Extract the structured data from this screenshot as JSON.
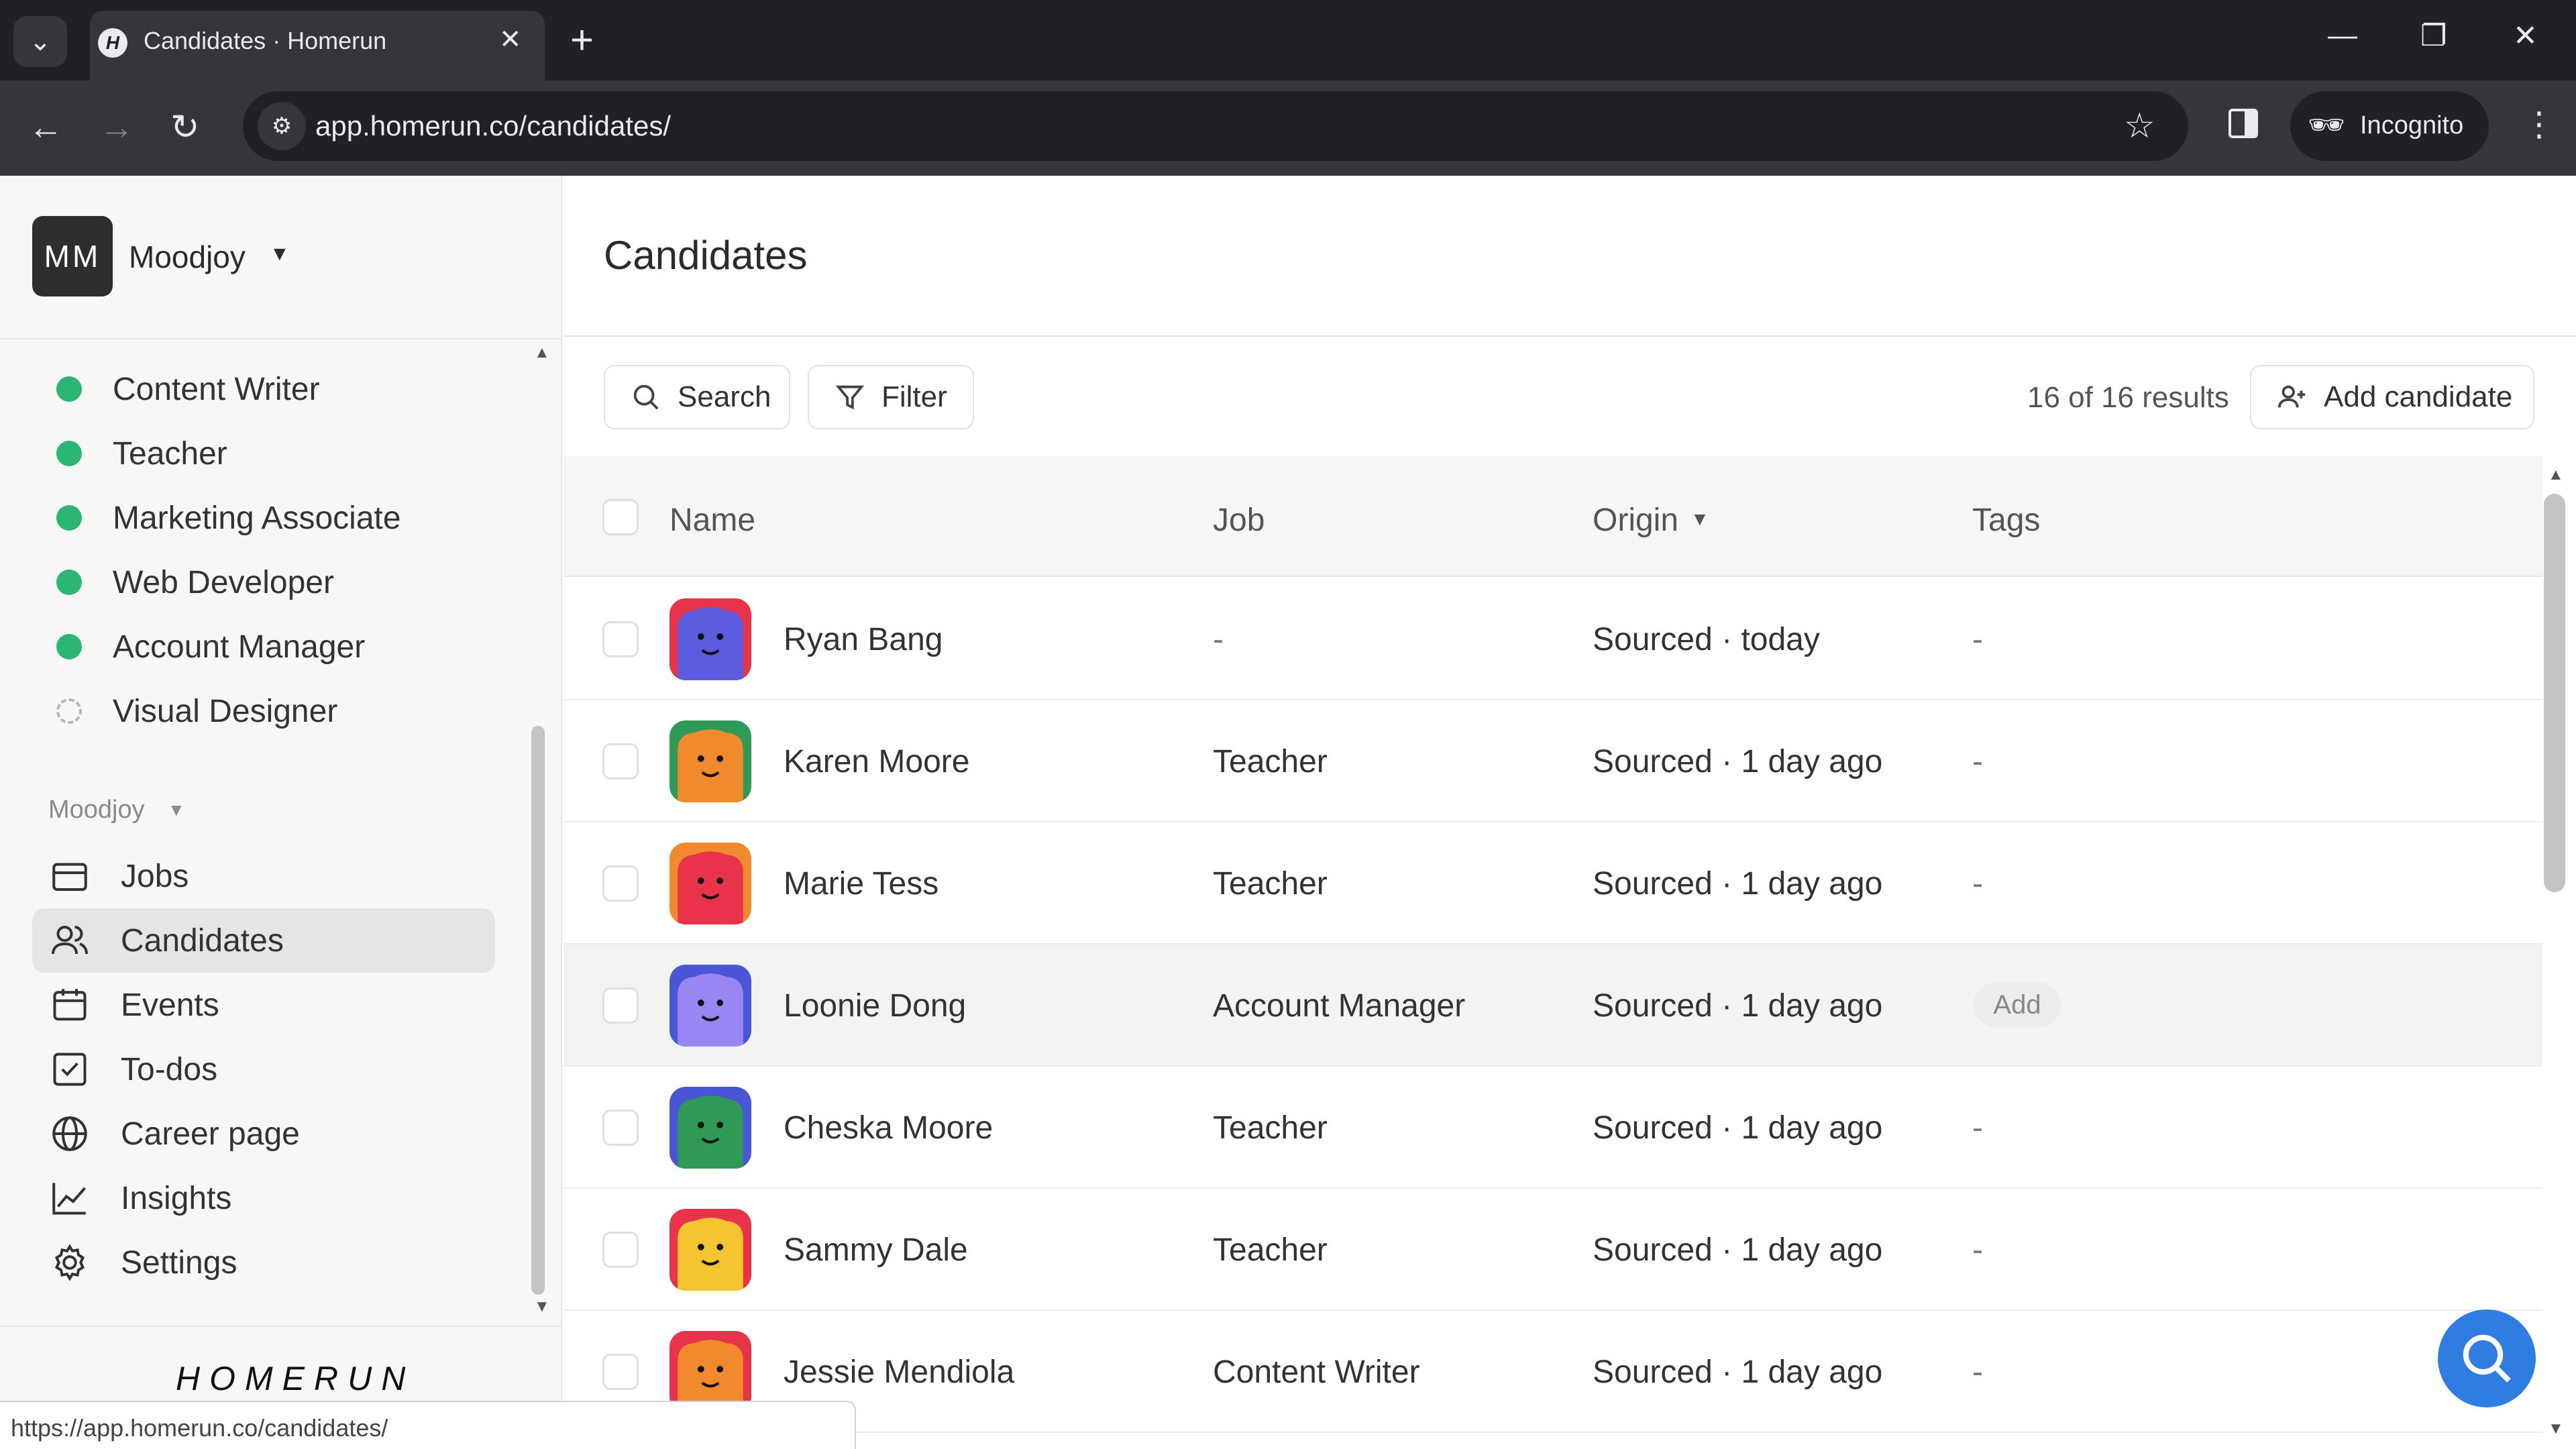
{
  "browser": {
    "tab_title": "Candidates · Homerun",
    "tab_favicon_letter": "H",
    "url": "app.homerun.co/candidates/",
    "incognito_label": "Incognito",
    "status_url": "https://app.homerun.co/candidates/"
  },
  "workspace": {
    "initials": "MM",
    "name": "Moodjoy"
  },
  "sidebar": {
    "jobs": [
      {
        "label": "Content Writer",
        "status": "published"
      },
      {
        "label": "Teacher",
        "status": "published"
      },
      {
        "label": "Marketing Associate",
        "status": "published"
      },
      {
        "label": "Web Developer",
        "status": "published"
      },
      {
        "label": "Account Manager",
        "status": "published"
      },
      {
        "label": "Visual Designer",
        "status": "draft"
      }
    ],
    "section_label": "Moodjoy",
    "nav": [
      {
        "label": "Jobs",
        "icon": "briefcase-icon"
      },
      {
        "label": "Candidates",
        "icon": "users-icon"
      },
      {
        "label": "Events",
        "icon": "calendar-icon"
      },
      {
        "label": "To-dos",
        "icon": "checkbox-icon"
      },
      {
        "label": "Career page",
        "icon": "globe-icon"
      },
      {
        "label": "Insights",
        "icon": "chart-icon"
      },
      {
        "label": "Settings",
        "icon": "gear-icon"
      }
    ],
    "active_nav": "Candidates",
    "brand": "HOMERUN"
  },
  "main": {
    "title": "Candidates",
    "search_label": "Search",
    "filter_label": "Filter",
    "results": "16 of 16 results",
    "add_candidate_label": "Add candidate",
    "columns": {
      "name": "Name",
      "job": "Job",
      "origin": "Origin",
      "tags": "Tags"
    },
    "rows": [
      {
        "name": "Ryan Bang",
        "job": "-",
        "origin": "Sourced · today",
        "tags": "-",
        "avatar_bg": "#e8334a",
        "avatar_fg": "#5b5ce0"
      },
      {
        "name": "Karen Moore",
        "job": "Teacher",
        "origin": "Sourced · 1 day ago",
        "tags": "-",
        "avatar_bg": "#2f9a57",
        "avatar_fg": "#f08a2c"
      },
      {
        "name": "Marie Tess",
        "job": "Teacher",
        "origin": "Sourced · 1 day ago",
        "tags": "-",
        "avatar_bg": "#f08a2c",
        "avatar_fg": "#e8334a"
      },
      {
        "name": "Loonie Dong",
        "job": "Account Manager",
        "origin": "Sourced · 1 day ago",
        "tags": "Add",
        "avatar_bg": "#4a56d8",
        "avatar_fg": "#9a86f2"
      },
      {
        "name": "Cheska Moore",
        "job": "Teacher",
        "origin": "Sourced · 1 day ago",
        "tags": "-",
        "avatar_bg": "#4a56d8",
        "avatar_fg": "#2f9a57"
      },
      {
        "name": "Sammy Dale",
        "job": "Teacher",
        "origin": "Sourced · 1 day ago",
        "tags": "-",
        "avatar_bg": "#e8334a",
        "avatar_fg": "#f5c531"
      },
      {
        "name": "Jessie Mendiola",
        "job": "Content Writer",
        "origin": "Sourced · 1 day ago",
        "tags": "-",
        "avatar_bg": "#e8334a",
        "avatar_fg": "#f08a2c"
      }
    ],
    "hovered_row": 3
  },
  "colors": {
    "published": "#2bb673",
    "help_button": "#2f7de0"
  }
}
